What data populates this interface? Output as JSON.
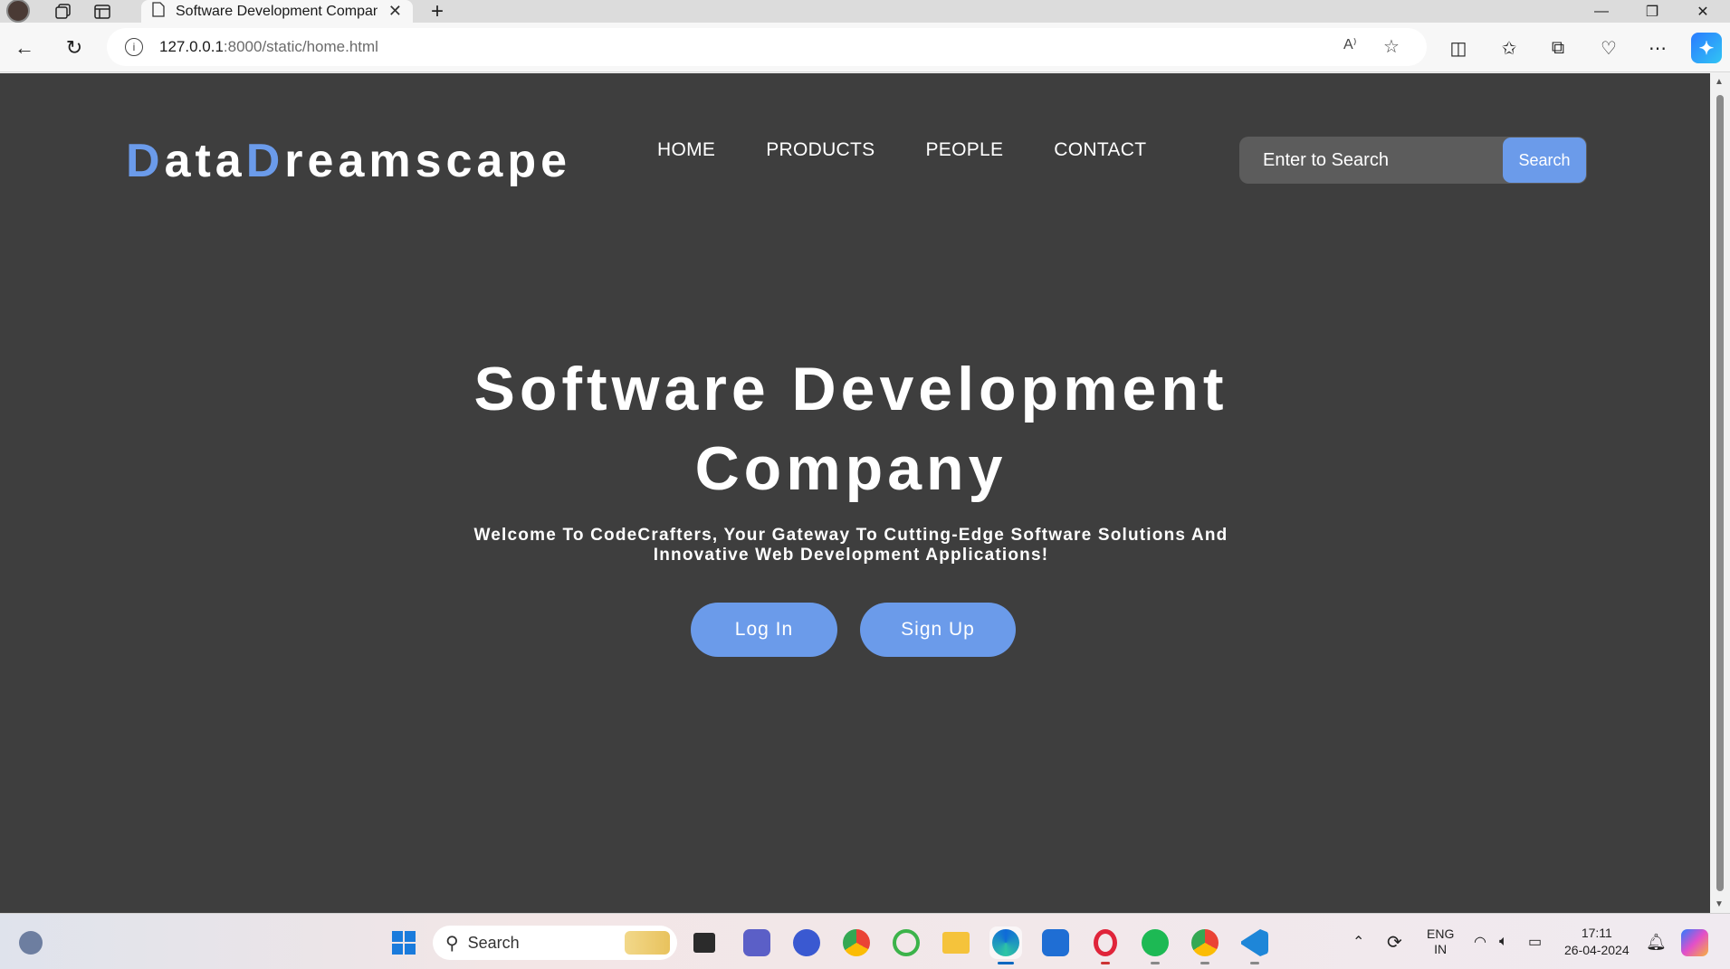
{
  "browser": {
    "tab_title": "Software Development Company",
    "url_host": "127.0.0.1",
    "url_path": ":8000/static/home.html",
    "read_aloud_label": "A⁾"
  },
  "site": {
    "logo": {
      "part1_accent": "D",
      "part1_rest": "ata",
      "part2_accent": "D",
      "part2_rest": "reamscape"
    },
    "nav": {
      "home": "HOME",
      "products": "PRODUCTS",
      "people": "PEOPLE",
      "contact": "CONTACT"
    },
    "search": {
      "placeholder": "Enter to Search",
      "button": "Search"
    },
    "hero": {
      "title_line1": "Software Development",
      "title_line2": "Company",
      "subtitle": "Welcome To CodeCrafters, Your Gateway To Cutting-Edge Software Solutions And Innovative Web Development Applications!",
      "login": "Log In",
      "signup": "Sign Up"
    },
    "colors": {
      "accent": "#6b9bea",
      "background": "#3e3e3e"
    }
  },
  "taskbar": {
    "search_label": "Search",
    "lang_line1": "ENG",
    "lang_line2": "IN",
    "time": "17:11",
    "date": "26-04-2024"
  }
}
